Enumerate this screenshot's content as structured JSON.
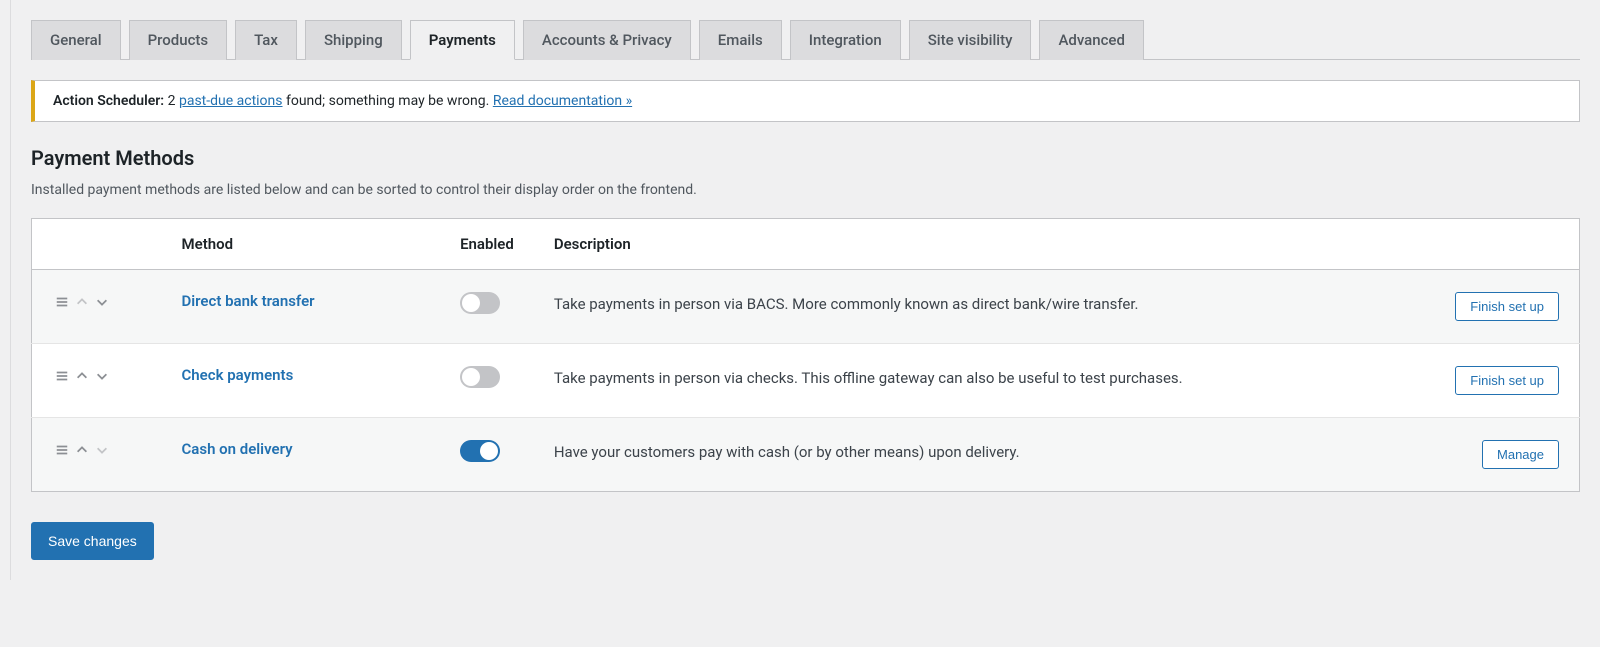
{
  "tabs": [
    {
      "label": "General",
      "active": false
    },
    {
      "label": "Products",
      "active": false
    },
    {
      "label": "Tax",
      "active": false
    },
    {
      "label": "Shipping",
      "active": false
    },
    {
      "label": "Payments",
      "active": true
    },
    {
      "label": "Accounts & Privacy",
      "active": false
    },
    {
      "label": "Emails",
      "active": false
    },
    {
      "label": "Integration",
      "active": false
    },
    {
      "label": "Site visibility",
      "active": false
    },
    {
      "label": "Advanced",
      "active": false
    }
  ],
  "notice": {
    "prefix": "Action Scheduler:",
    "count": "2",
    "link1": "past-due actions",
    "middle": " found; something may be wrong. ",
    "link2": "Read documentation »"
  },
  "section": {
    "title": "Payment Methods",
    "desc": "Installed payment methods are listed below and can be sorted to control their display order on the frontend."
  },
  "columns": {
    "method": "Method",
    "enabled": "Enabled",
    "description": "Description"
  },
  "methods": [
    {
      "name": "Direct bank transfer",
      "enabled": false,
      "desc": "Take payments in person via BACS. More commonly known as direct bank/wire transfer.",
      "action": "Finish set up",
      "up_disabled": true,
      "down_disabled": false
    },
    {
      "name": "Check payments",
      "enabled": false,
      "desc": "Take payments in person via checks. This offline gateway can also be useful to test purchases.",
      "action": "Finish set up",
      "up_disabled": false,
      "down_disabled": false
    },
    {
      "name": "Cash on delivery",
      "enabled": true,
      "desc": "Have your customers pay with cash (or by other means) upon delivery.",
      "action": "Manage",
      "up_disabled": false,
      "down_disabled": true
    }
  ],
  "save_label": "Save changes"
}
